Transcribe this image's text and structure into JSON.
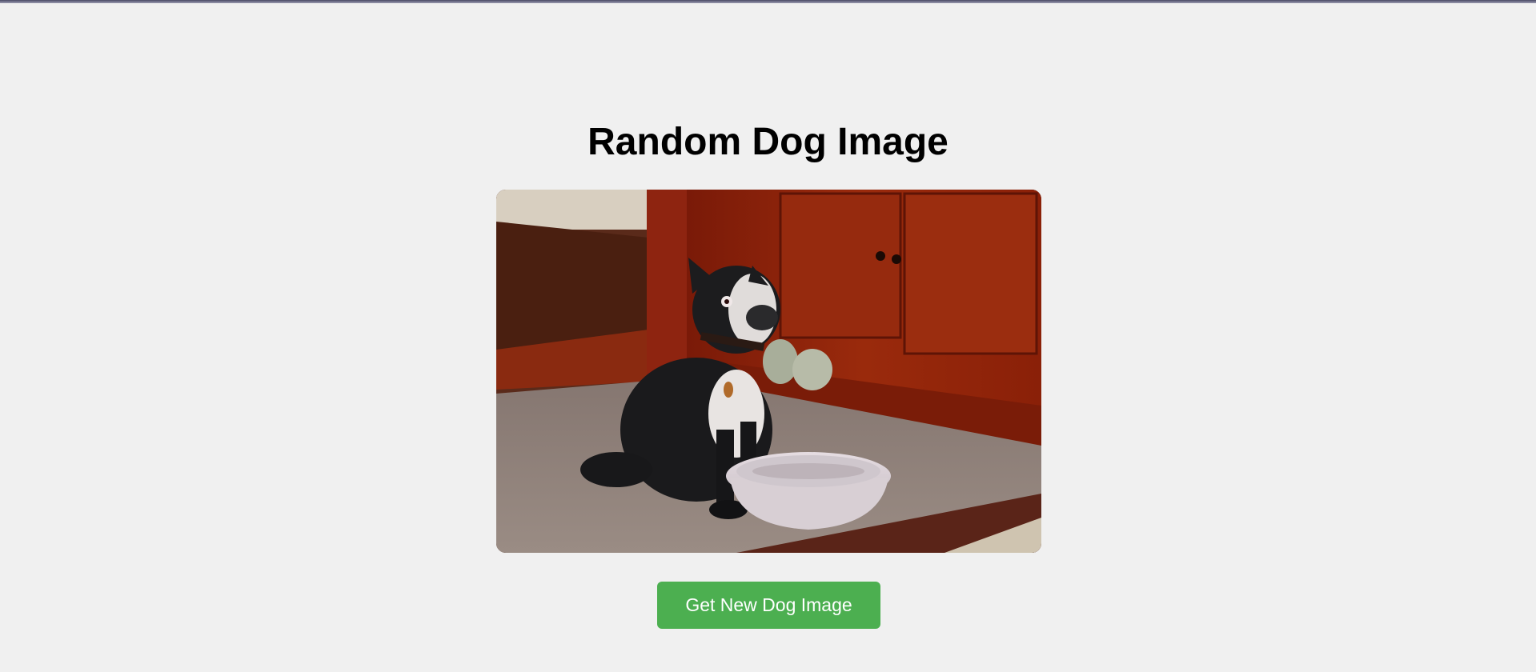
{
  "page": {
    "title": "Random Dog Image",
    "background": "#f0f0f0"
  },
  "dog_image": {
    "icon": "dog-photo",
    "subject": "black and white dog sitting beside a water bowl"
  },
  "actions": {
    "new_image_label": "Get New Dog Image",
    "button_color": "#4caf50"
  }
}
